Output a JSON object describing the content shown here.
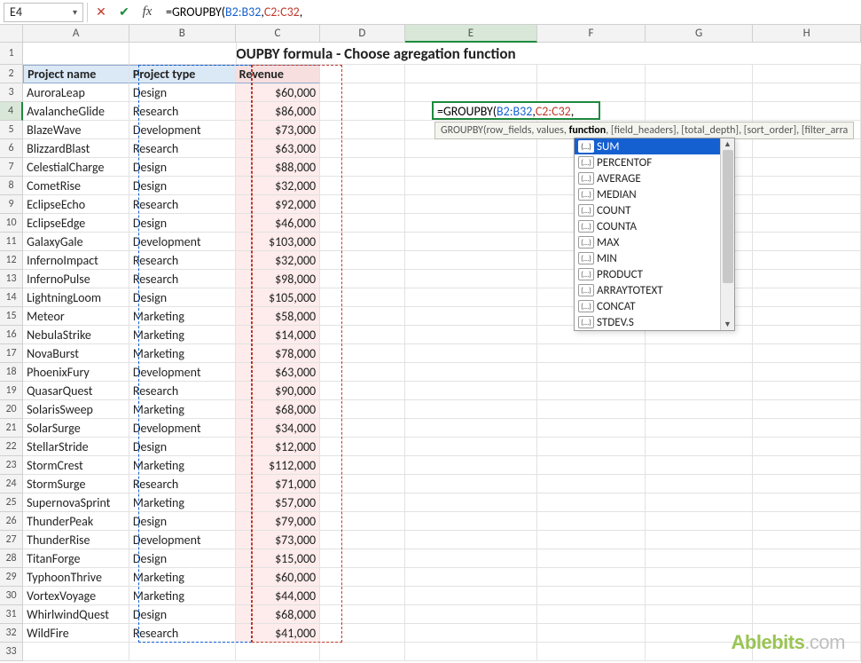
{
  "formula_bar": {
    "cell_ref": "E4",
    "formula_prefix": "=GROUPBY(",
    "range1": "B2:B32",
    "sep": ", ",
    "range2": "C2:C32",
    "suffix": ","
  },
  "title": "Excel GROUPBY formula - Choose agregation function",
  "columns": [
    "A",
    "B",
    "C",
    "D",
    "E",
    "F",
    "G",
    "H"
  ],
  "headers": {
    "A": "Project name",
    "B": "Project type",
    "C": "Revenue"
  },
  "rows": [
    {
      "n": 3,
      "a": "AuroraLeap",
      "b": "Design",
      "c": "$60,000"
    },
    {
      "n": 4,
      "a": "AvalancheGlide",
      "b": "Research",
      "c": "$86,000"
    },
    {
      "n": 5,
      "a": "BlazeWave",
      "b": "Development",
      "c": "$73,000"
    },
    {
      "n": 6,
      "a": "BlizzardBlast",
      "b": "Research",
      "c": "$63,000"
    },
    {
      "n": 7,
      "a": "CelestialCharge",
      "b": "Design",
      "c": "$88,000"
    },
    {
      "n": 8,
      "a": "CometRise",
      "b": "Design",
      "c": "$32,000"
    },
    {
      "n": 9,
      "a": "EclipseEcho",
      "b": "Research",
      "c": "$92,000"
    },
    {
      "n": 10,
      "a": "EclipseEdge",
      "b": "Design",
      "c": "$46,000"
    },
    {
      "n": 11,
      "a": "GalaxyGale",
      "b": "Development",
      "c": "$103,000"
    },
    {
      "n": 12,
      "a": "InfernoImpact",
      "b": "Research",
      "c": "$32,000"
    },
    {
      "n": 13,
      "a": "InfernoPulse",
      "b": "Research",
      "c": "$98,000"
    },
    {
      "n": 14,
      "a": "LightningLoom",
      "b": "Design",
      "c": "$105,000"
    },
    {
      "n": 15,
      "a": "Meteor",
      "b": "Marketing",
      "c": "$58,000"
    },
    {
      "n": 16,
      "a": "NebulaStrike",
      "b": "Marketing",
      "c": "$14,000"
    },
    {
      "n": 17,
      "a": "NovaBurst",
      "b": "Marketing",
      "c": "$78,000"
    },
    {
      "n": 18,
      "a": "PhoenixFury",
      "b": "Development",
      "c": "$63,000"
    },
    {
      "n": 19,
      "a": "QuasarQuest",
      "b": "Research",
      "c": "$90,000"
    },
    {
      "n": 20,
      "a": "SolarisSweep",
      "b": "Marketing",
      "c": "$68,000"
    },
    {
      "n": 21,
      "a": "SolarSurge",
      "b": "Development",
      "c": "$34,000"
    },
    {
      "n": 22,
      "a": "StellarStride",
      "b": "Design",
      "c": "$12,000"
    },
    {
      "n": 23,
      "a": "StormCrest",
      "b": "Marketing",
      "c": "$112,000"
    },
    {
      "n": 24,
      "a": "StormSurge",
      "b": "Research",
      "c": "$71,000"
    },
    {
      "n": 25,
      "a": "SupernovaSprint",
      "b": "Marketing",
      "c": "$57,000"
    },
    {
      "n": 26,
      "a": "ThunderPeak",
      "b": "Design",
      "c": "$79,000"
    },
    {
      "n": 27,
      "a": "ThunderRise",
      "b": "Development",
      "c": "$73,000"
    },
    {
      "n": 28,
      "a": "TitanForge",
      "b": "Design",
      "c": "$15,000"
    },
    {
      "n": 29,
      "a": "TyphoonThrive",
      "b": "Marketing",
      "c": "$60,000"
    },
    {
      "n": 30,
      "a": "VortexVoyage",
      "b": "Marketing",
      "c": "$44,000"
    },
    {
      "n": 31,
      "a": "WhirlwindQuest",
      "b": "Design",
      "c": "$68,000"
    },
    {
      "n": 32,
      "a": "WildFire",
      "b": "Research",
      "c": "$41,000"
    }
  ],
  "tooltip": {
    "fn": "GROUPBY(",
    "arg1": "row_fields",
    "arg2": "values",
    "arg3": "function",
    "rest": ", [field_headers], [total_depth], [sort_order], [filter_arra"
  },
  "dropdown": {
    "items": [
      "SUM",
      "PERCENTOF",
      "AVERAGE",
      "MEDIAN",
      "COUNT",
      "COUNTA",
      "MAX",
      "MIN",
      "PRODUCT",
      "ARRAYTOTEXT",
      "CONCAT",
      "STDEV.S"
    ],
    "selected": 0
  },
  "watermark": {
    "brand": "Ablebits",
    "suffix": ".com"
  }
}
